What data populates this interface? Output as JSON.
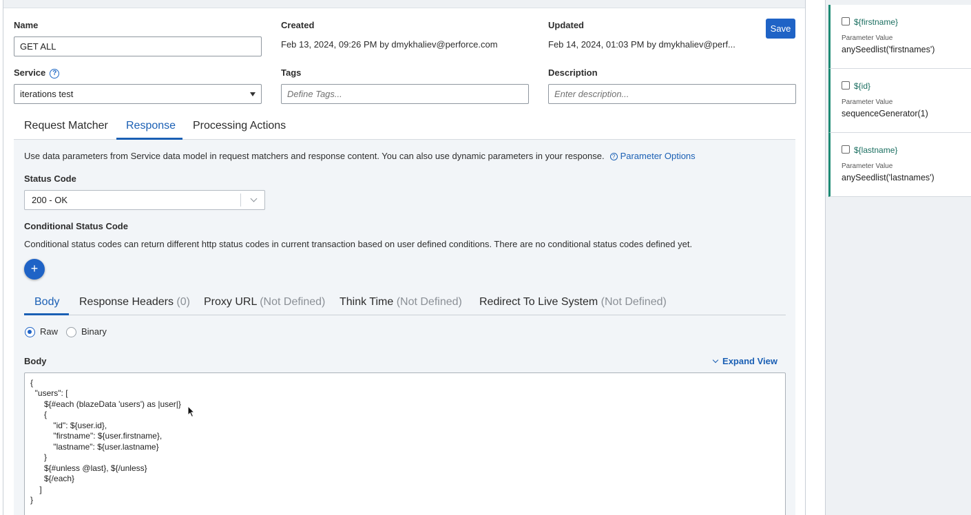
{
  "form": {
    "name_label": "Name",
    "name_value": "GET ALL",
    "created_label": "Created",
    "created_value": "Feb 13, 2024, 09:26 PM by dmykhaliev@perforce.com",
    "updated_label": "Updated",
    "updated_value": "Feb 14, 2024, 01:03 PM by dmykhaliev@perf...",
    "save_label": "Save",
    "service_label": "Service",
    "service_value": "iterations test",
    "tags_label": "Tags",
    "tags_placeholder": "Define Tags...",
    "description_label": "Description",
    "description_placeholder": "Enter description..."
  },
  "tabs": [
    {
      "label": "Request Matcher",
      "active": false
    },
    {
      "label": "Response",
      "active": true
    },
    {
      "label": "Processing Actions",
      "active": false
    }
  ],
  "response": {
    "intro": "Use data parameters from Service data model in request matchers and response content. You can also use dynamic parameters in your response.",
    "param_options": "Parameter Options",
    "status_code_label": "Status Code",
    "status_code_value": "200 - OK",
    "conditional_label": "Conditional Status Code",
    "conditional_text": "Conditional status codes can return different http status codes in current transaction based on user defined conditions. There are no conditional status codes defined yet.",
    "add_symbol": "+"
  },
  "subtabs": [
    {
      "label": "Body",
      "note": ""
    },
    {
      "label": "Response Headers",
      "note": "(0)"
    },
    {
      "label": "Proxy URL",
      "note": "(Not Defined)"
    },
    {
      "label": "Think Time",
      "note": "(Not Defined)"
    },
    {
      "label": "Redirect To Live System",
      "note": "(Not Defined)"
    }
  ],
  "body_type": {
    "raw": "Raw",
    "binary": "Binary",
    "selected": "Raw"
  },
  "body": {
    "label": "Body",
    "expand": "Expand View",
    "code_lines": [
      "{",
      "  \"users\": [",
      "      ${#each (blazeData 'users') as |user|}",
      "      {",
      "          \"id\": ${user.id},",
      "          \"firstname\": ${user.firstname},",
      "          \"lastname\": ${user.lastname}",
      "      }",
      "      ${#unless @last}, ${/unless}",
      "      ${/each}",
      "    ]",
      "}"
    ]
  },
  "parameters": [
    {
      "name": "${firstname}",
      "label": "Parameter Value",
      "value": "anySeedlist('firstnames')"
    },
    {
      "name": "${id}",
      "label": "Parameter Value",
      "value": "sequenceGenerator(1)"
    },
    {
      "name": "${lastname}",
      "label": "Parameter Value",
      "value": "anySeedlist('lastnames')"
    }
  ],
  "colors": {
    "primary": "#1f63c6",
    "link": "#1a5fb4",
    "param_accent": "#1d8a73"
  }
}
